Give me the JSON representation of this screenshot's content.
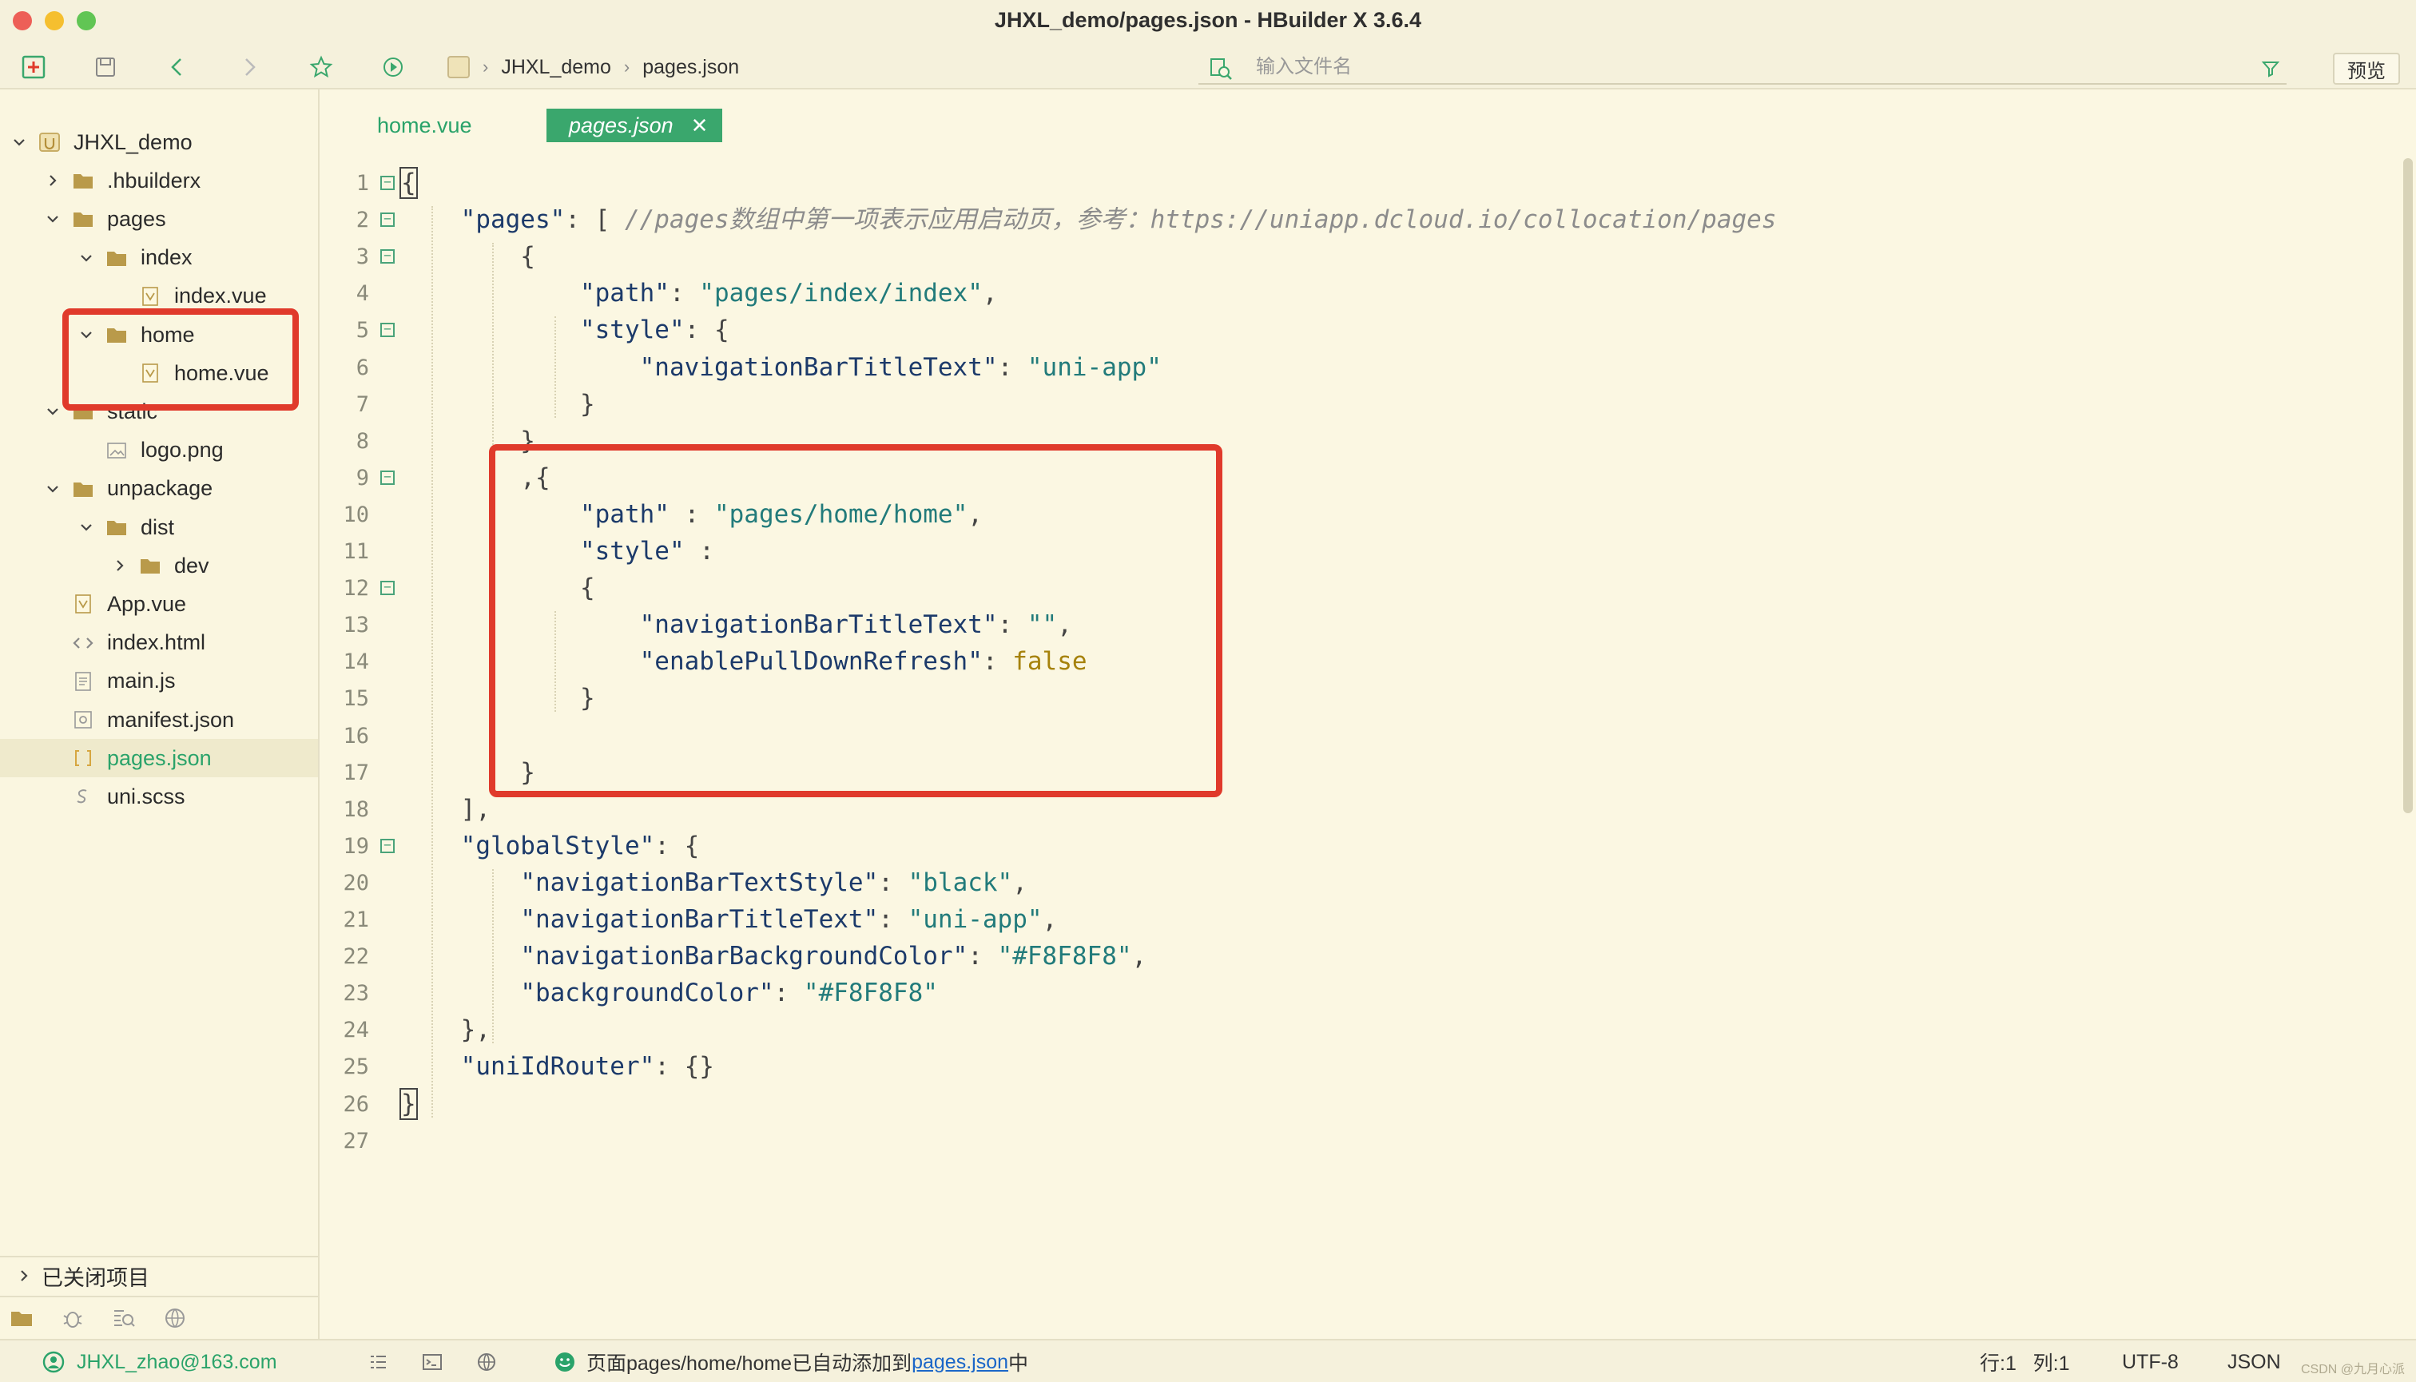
{
  "window": {
    "title": "JHXL_demo/pages.json - HBuilder X 3.6.4"
  },
  "toolbar": {
    "breadcrumb": [
      "JHXL_demo",
      "pages.json"
    ],
    "search_placeholder": "输入文件名",
    "preview_label": "预览"
  },
  "sidebar": {
    "tree": [
      {
        "label": "JHXL_demo",
        "depth": 0,
        "type": "project",
        "caret": "down"
      },
      {
        "label": ".hbuilderx",
        "depth": 1,
        "type": "folder",
        "caret": "right"
      },
      {
        "label": "pages",
        "depth": 1,
        "type": "folder",
        "caret": "down"
      },
      {
        "label": "index",
        "depth": 2,
        "type": "folder",
        "caret": "down"
      },
      {
        "label": "index.vue",
        "depth": 3,
        "type": "vue",
        "caret": "none"
      },
      {
        "label": "home",
        "depth": 2,
        "type": "folder",
        "caret": "down"
      },
      {
        "label": "home.vue",
        "depth": 3,
        "type": "vue",
        "caret": "none"
      },
      {
        "label": "static",
        "depth": 1,
        "type": "folder",
        "caret": "down"
      },
      {
        "label": "logo.png",
        "depth": 2,
        "type": "image",
        "caret": "none"
      },
      {
        "label": "unpackage",
        "depth": 1,
        "type": "folder",
        "caret": "down"
      },
      {
        "label": "dist",
        "depth": 2,
        "type": "folder",
        "caret": "down"
      },
      {
        "label": "dev",
        "depth": 3,
        "type": "folder",
        "caret": "right"
      },
      {
        "label": "App.vue",
        "depth": 1,
        "type": "vue",
        "caret": "none"
      },
      {
        "label": "index.html",
        "depth": 1,
        "type": "html",
        "caret": "none"
      },
      {
        "label": "main.js",
        "depth": 1,
        "type": "js",
        "caret": "none"
      },
      {
        "label": "manifest.json",
        "depth": 1,
        "type": "manifest",
        "caret": "none"
      },
      {
        "label": "pages.json",
        "depth": 1,
        "type": "json",
        "caret": "none",
        "active": true
      },
      {
        "label": "uni.scss",
        "depth": 1,
        "type": "scss",
        "caret": "none"
      }
    ],
    "closed_projects_label": "已关闭项目"
  },
  "tabs": [
    {
      "label": "home.vue",
      "active": false
    },
    {
      "label": "pages.json",
      "active": true,
      "close": "✕"
    }
  ],
  "editor": {
    "line_numbers": [
      "1",
      "2",
      "3",
      "4",
      "5",
      "6",
      "7",
      "8",
      "9",
      "10",
      "11",
      "12",
      "13",
      "14",
      "15",
      "16",
      "17",
      "18",
      "19",
      "20",
      "21",
      "22",
      "23",
      "24",
      "25",
      "26",
      "27"
    ],
    "lines": [
      [
        [
          "p",
          "{"
        ]
      ],
      [
        [
          "p",
          "    "
        ],
        [
          "k",
          "\"pages\""
        ],
        [
          "p",
          ": [ "
        ],
        [
          "c",
          "//pages数组中第一项表示应用启动页，参考：https://uniapp.dcloud.io/collocation/pages"
        ]
      ],
      [
        [
          "p",
          "        {"
        ]
      ],
      [
        [
          "p",
          "            "
        ],
        [
          "k",
          "\"path\""
        ],
        [
          "p",
          ": "
        ],
        [
          "s",
          "\"pages/index/index\""
        ],
        [
          "p",
          ","
        ]
      ],
      [
        [
          "p",
          "            "
        ],
        [
          "k",
          "\"style\""
        ],
        [
          "p",
          ": {"
        ]
      ],
      [
        [
          "p",
          "                "
        ],
        [
          "k",
          "\"navigationBarTitleText\""
        ],
        [
          "p",
          ": "
        ],
        [
          "s",
          "\"uni-app\""
        ]
      ],
      [
        [
          "p",
          "            }"
        ]
      ],
      [
        [
          "p",
          "        }"
        ]
      ],
      [
        [
          "p",
          "        ,{"
        ]
      ],
      [
        [
          "p",
          "            "
        ],
        [
          "k",
          "\"path\""
        ],
        [
          "p",
          " : "
        ],
        [
          "s",
          "\"pages/home/home\""
        ],
        [
          "p",
          ","
        ]
      ],
      [
        [
          "p",
          "            "
        ],
        [
          "k",
          "\"style\""
        ],
        [
          "p",
          " :"
        ]
      ],
      [
        [
          "p",
          "            {"
        ]
      ],
      [
        [
          "p",
          "                "
        ],
        [
          "k",
          "\"navigationBarTitleText\""
        ],
        [
          "p",
          ": "
        ],
        [
          "s",
          "\"\""
        ],
        [
          "p",
          ","
        ]
      ],
      [
        [
          "p",
          "                "
        ],
        [
          "k",
          "\"enablePullDownRefresh\""
        ],
        [
          "p",
          ": "
        ],
        [
          "b",
          "false"
        ]
      ],
      [
        [
          "p",
          "            }"
        ]
      ],
      [
        [
          "p",
          ""
        ]
      ],
      [
        [
          "p",
          "        }"
        ]
      ],
      [
        [
          "p",
          "    ],"
        ]
      ],
      [
        [
          "p",
          "    "
        ],
        [
          "k",
          "\"globalStyle\""
        ],
        [
          "p",
          ": {"
        ]
      ],
      [
        [
          "p",
          "        "
        ],
        [
          "k",
          "\"navigationBarTextStyle\""
        ],
        [
          "p",
          ": "
        ],
        [
          "s",
          "\"black\""
        ],
        [
          "p",
          ","
        ]
      ],
      [
        [
          "p",
          "        "
        ],
        [
          "k",
          "\"navigationBarTitleText\""
        ],
        [
          "p",
          ": "
        ],
        [
          "s",
          "\"uni-app\""
        ],
        [
          "p",
          ","
        ]
      ],
      [
        [
          "p",
          "        "
        ],
        [
          "k",
          "\"navigationBarBackgroundColor\""
        ],
        [
          "p",
          ": "
        ],
        [
          "s",
          "\"#F8F8F8\""
        ],
        [
          "p",
          ","
        ]
      ],
      [
        [
          "p",
          "        "
        ],
        [
          "k",
          "\"backgroundColor\""
        ],
        [
          "p",
          ": "
        ],
        [
          "s",
          "\"#F8F8F8\""
        ]
      ],
      [
        [
          "p",
          "    },"
        ]
      ],
      [
        [
          "p",
          "    "
        ],
        [
          "k",
          "\"uniIdRouter\""
        ],
        [
          "p",
          ": {}"
        ]
      ],
      [
        [
          "p",
          "}"
        ]
      ],
      [
        [
          "p",
          ""
        ]
      ]
    ],
    "fold_lines": [
      1,
      2,
      3,
      5,
      9,
      12,
      19
    ]
  },
  "statusbar": {
    "user": "JHXL_zhao@163.com",
    "message_prefix": "页面pages/home/home已自动添加到",
    "message_link": "pages.json",
    "message_suffix": "中",
    "position": "行:1   列:1",
    "encoding": "UTF-8",
    "language": "JSON",
    "watermark": "CSDN @九月心派"
  },
  "colors": {
    "accent_green": "#3aa76d",
    "highlight_red": "#e03a2b",
    "background": "#fbf7e2"
  }
}
